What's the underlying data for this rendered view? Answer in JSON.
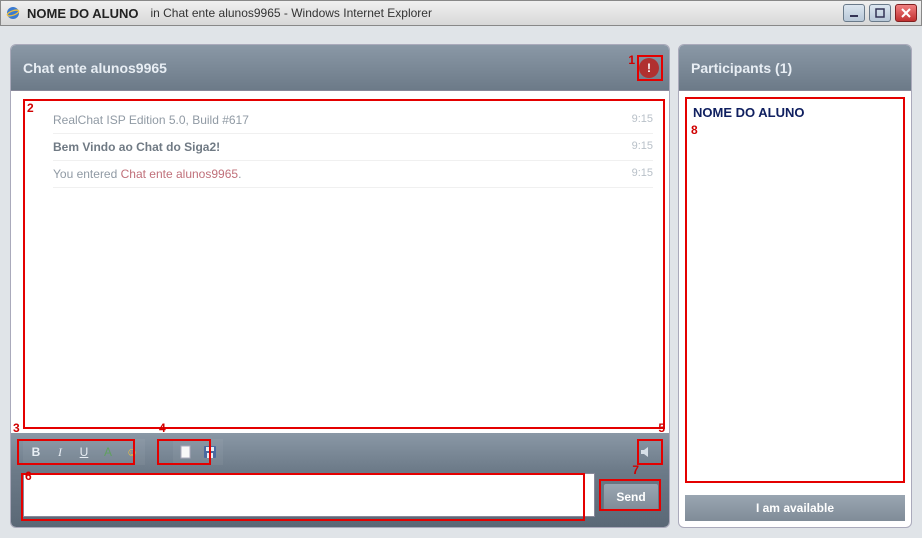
{
  "window": {
    "user_name": "NOME DO ALUNO",
    "title_suffix": "in Chat ente alunos9965 - Windows Internet Explorer"
  },
  "chat": {
    "header": "Chat ente alunos9965",
    "messages": [
      {
        "text": "RealChat ISP Edition 5.0, Build #617",
        "time": "9:15",
        "strong": false,
        "has_link": false
      },
      {
        "text": "Bem Vindo ao Chat do Siga2!",
        "time": "9:15",
        "strong": true,
        "has_link": false
      },
      {
        "prefix": "You entered ",
        "link": "Chat ente alunos9965",
        "suffix": ".",
        "time": "9:15",
        "strong": false,
        "has_link": true
      }
    ]
  },
  "toolbar": {
    "bold": "B",
    "italic": "I",
    "underline": "U",
    "color": "A",
    "smiley": "☺",
    "new": "□",
    "save": "💾",
    "sound": "🔊"
  },
  "input": {
    "send_label": "Send",
    "placeholder": ""
  },
  "participants": {
    "header": "Participants (1)",
    "list": [
      {
        "name": "NOME DO ALUNO"
      }
    ],
    "status_label": "I am available"
  },
  "annotations": {
    "n1": "1",
    "n2": "2",
    "n3": "3",
    "n4": "4",
    "n5": "5",
    "n6": "6",
    "n7": "7",
    "n8": "8"
  },
  "icons": {
    "info": "!"
  }
}
